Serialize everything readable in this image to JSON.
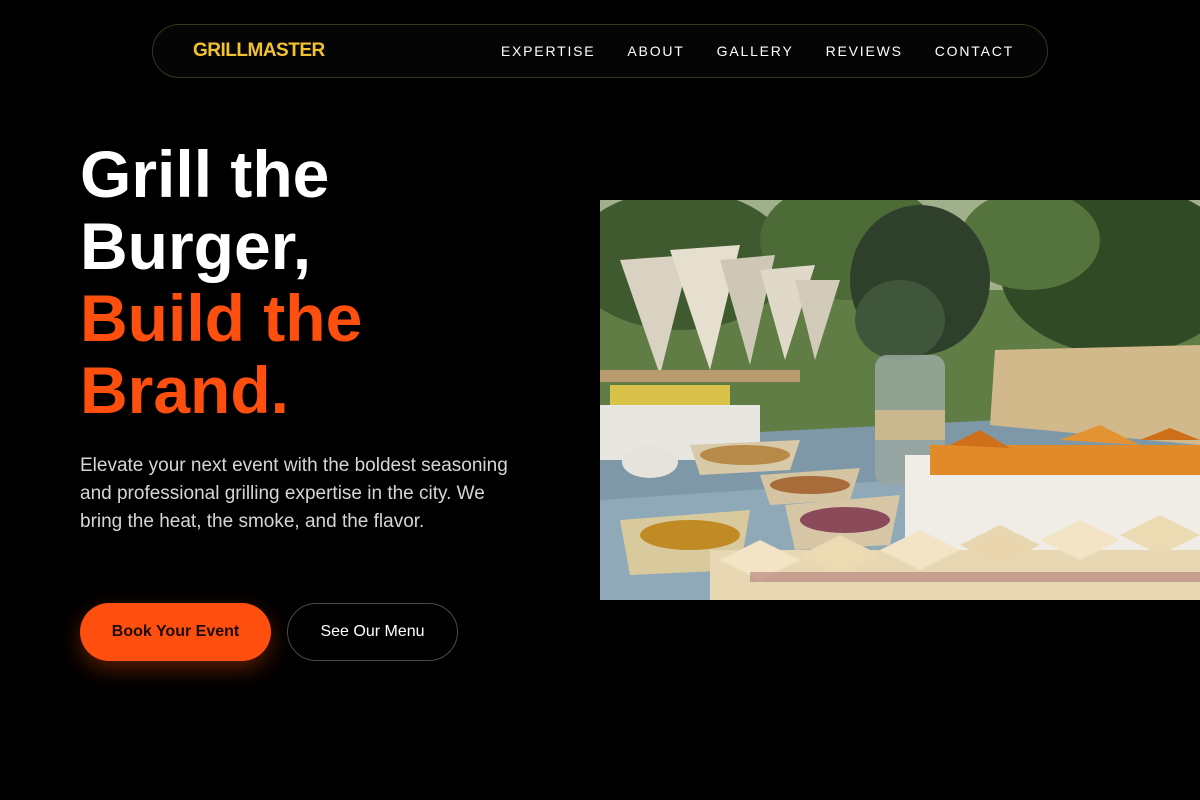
{
  "nav": {
    "brand": "GRILLMASTER",
    "links": [
      "EXPERTISE",
      "ABOUT",
      "GALLERY",
      "REVIEWS",
      "CONTACT"
    ]
  },
  "hero": {
    "title_line1": "Grill the",
    "title_line2": "Burger,",
    "title_line3": "Build the",
    "title_line4": "Brand.",
    "description": "Elevate your next event with the boldest seasoning and professional grilling expertise in the city. We bring the heat, the smoke, and the flavor.",
    "primary_button": "Book Your Event",
    "secondary_button": "See Our Menu"
  },
  "colors": {
    "background": "#000000",
    "brand": "#f2c230",
    "accent": "#ff4f0f",
    "text": "#ffffff",
    "muted_text": "#d6d6d6"
  }
}
